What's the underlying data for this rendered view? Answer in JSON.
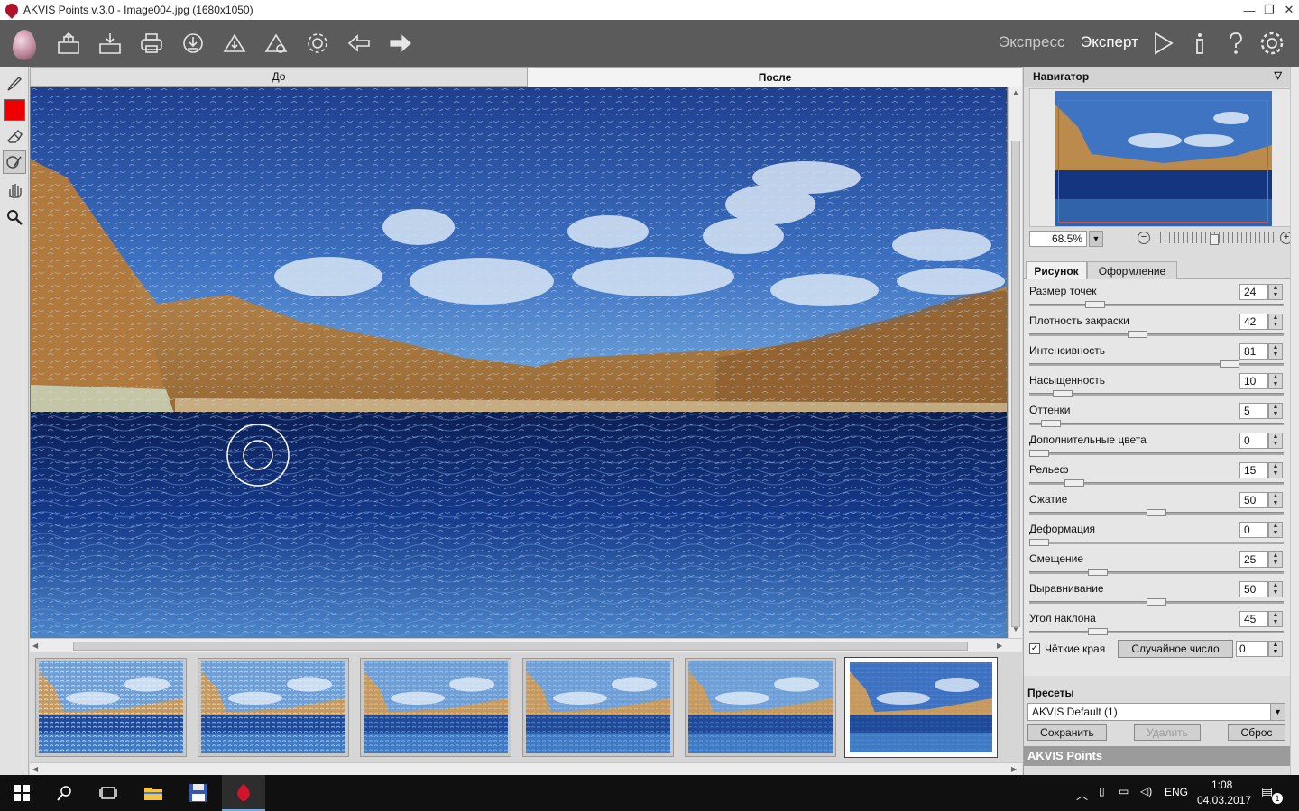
{
  "window": {
    "title": "AKVIS Points v.3.0 - Image004.jpg (1680x1050)",
    "controls": [
      "—",
      "❐",
      "✕"
    ]
  },
  "toolbar": {
    "mode_express": "Экспресс",
    "mode_expert": "Эксперт",
    "icons": [
      "open-image-icon",
      "save-image-icon",
      "print-icon",
      "share-icon",
      "import-preset-icon",
      "export-preset-icon",
      "batch-settings-icon",
      "back-icon",
      "forward-icon"
    ],
    "right_icons": [
      "run-icon",
      "info-icon",
      "help-icon",
      "preferences-icon"
    ]
  },
  "left_tools": {
    "icons": [
      "brush-icon",
      "color-swatch",
      "eraser-icon",
      "history-brush-icon",
      "hand-icon",
      "zoom-icon"
    ],
    "color": "#ee0000"
  },
  "canvas_tabs": {
    "before": "До",
    "after": "После"
  },
  "navigator": {
    "title": "Навигатор",
    "zoom": "68.5%"
  },
  "settings": {
    "tab_picture": "Рисунок",
    "tab_decoration": "Оформление",
    "params": [
      {
        "label": "Размер точек",
        "value": "24",
        "pos": 0.24
      },
      {
        "label": "Плотность закраски",
        "value": "42",
        "pos": 0.42
      },
      {
        "label": "Интенсивность",
        "value": "81",
        "pos": 0.81
      },
      {
        "label": "Насыщенность",
        "value": "10",
        "pos": 0.1
      },
      {
        "label": "Оттенки",
        "value": "5",
        "pos": 0.05
      },
      {
        "label": "Дополнительные цвета",
        "value": "0",
        "pos": 0.0
      },
      {
        "label": "Рельеф",
        "value": "15",
        "pos": 0.15
      },
      {
        "label": "Сжатие",
        "value": "50",
        "pos": 0.5
      },
      {
        "label": "Деформация",
        "value": "0",
        "pos": 0.0
      },
      {
        "label": "Смещение",
        "value": "25",
        "pos": 0.25
      },
      {
        "label": "Выравнивание",
        "value": "50",
        "pos": 0.5
      },
      {
        "label": "Угол наклона",
        "value": "45",
        "pos": 0.25
      }
    ],
    "sharp_edges_label": "Чёткие края",
    "sharp_edges_checked": true,
    "random_button": "Случайное число",
    "random_value": "0"
  },
  "presets": {
    "title": "Пресеты",
    "selected": "AKVIS Default (1)",
    "save": "Сохранить",
    "delete": "Удалить",
    "reset": "Сброс",
    "footer": "AKVIS Points"
  },
  "thumbnails": {
    "count": 6,
    "selected_index": 5,
    "noise_levels": [
      0.9,
      0.75,
      0.5,
      0.4,
      0.3,
      0.15
    ]
  },
  "taskbar": {
    "icons": [
      "windows-start-icon",
      "search-icon",
      "task-view-icon",
      "file-explorer-icon",
      "save-app-icon",
      "akvis-points-app-icon"
    ],
    "tray_lang": "ENG",
    "time": "1:08",
    "date": "04.03.2017",
    "notifications": "1"
  }
}
